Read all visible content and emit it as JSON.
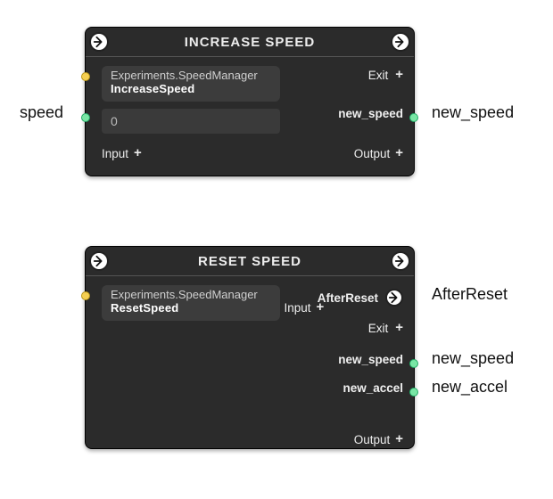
{
  "nodes": {
    "increase": {
      "title": "INCREASE SPEED",
      "script_ns": "Experiments.SpeedManager",
      "script_fn": "IncreaseSpeed",
      "value": "0",
      "add_input_label": "Input",
      "add_output_label": "Output",
      "ports": {
        "exit_label": "Exit",
        "out_label": "new_speed"
      }
    },
    "reset": {
      "title": "RESET SPEED",
      "script_ns": "Experiments.SpeedManager",
      "script_fn": "ResetSpeed",
      "add_input_label": "Input",
      "add_output_label": "Output",
      "ports": {
        "afterreset_label": "AfterReset",
        "exit_label": "Exit",
        "new_speed_label": "new_speed",
        "new_accel_label": "new_accel"
      }
    }
  },
  "outside": {
    "speed": "speed",
    "new_speed_top": "new_speed",
    "afterreset": "AfterReset",
    "new_speed_bot": "new_speed",
    "new_accel": "new_accel"
  }
}
